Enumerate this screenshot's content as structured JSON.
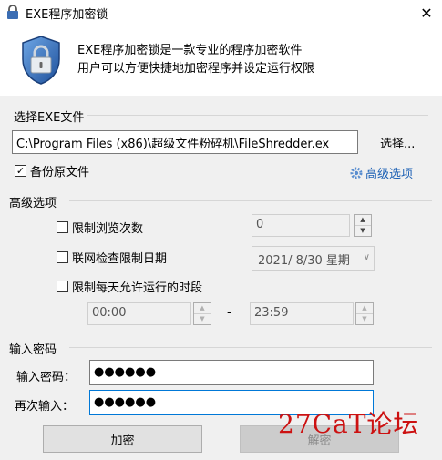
{
  "window": {
    "title": "EXE程序加密锁",
    "close_glyph": "✕"
  },
  "header": {
    "line1": "EXE程序加密锁是一款专业的程序加密软件",
    "line2": "用户可以方便快捷地加密程序并设定运行权限"
  },
  "select_file": {
    "section_label": "选择EXE文件",
    "path_value": "C:\\Program Files (x86)\\超级文件粉碎机\\FileShredder.ex",
    "browse_label": "选择...",
    "backup_label": "备份原文件",
    "backup_checked": true,
    "advanced_label": "高级选项"
  },
  "advanced": {
    "section_label": "高级选项",
    "limit_views_label": "限制浏览次数",
    "limit_views_value": "0",
    "online_check_label": "联网检查限制日期",
    "date_value": "2021/  8/30 星期",
    "daily_time_label": "限制每天允许运行的时段",
    "time_start": "00:00",
    "time_dash": "-",
    "time_end": "23:59"
  },
  "password": {
    "section_label": "输入密码",
    "pw_label": "输入密码：",
    "pw_value": "●●●●●●",
    "confirm_label": "再次输入：",
    "confirm_value": "●●●●●●"
  },
  "buttons": {
    "encrypt": "加密",
    "decrypt": "解密"
  },
  "watermark": "27CaT论坛"
}
